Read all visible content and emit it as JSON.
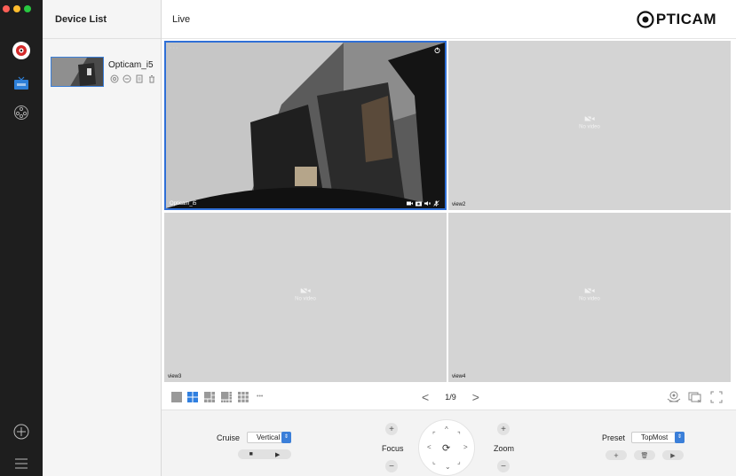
{
  "sidebar": {
    "nav": [
      "camera-logo-icon",
      "live-view-icon",
      "playback-reel-icon",
      "add-icon",
      "menu-icon"
    ]
  },
  "device_panel": {
    "title": "Device List",
    "devices": [
      {
        "name": "Opticam_i5",
        "actions": [
          "settings-icon",
          "link-icon",
          "file-icon",
          "delete-icon"
        ]
      }
    ]
  },
  "header": {
    "title": "Live",
    "brand": "PTICAM"
  },
  "views": [
    {
      "label": "Opticam_i5",
      "has_video": true
    },
    {
      "label": "view2",
      "has_video": false,
      "placeholder": "No video"
    },
    {
      "label": "view3",
      "has_video": false,
      "placeholder": "No video"
    },
    {
      "label": "view4",
      "has_video": false,
      "placeholder": "No video"
    }
  ],
  "toolbar": {
    "layouts": [
      "layout-1",
      "layout-4",
      "layout-6",
      "layout-8",
      "layout-9",
      "more"
    ],
    "more_label": "•••",
    "page": "1/9",
    "prev": "<",
    "next": ">"
  },
  "ptz": {
    "cruise_label": "Cruise",
    "cruise_value": "Vertical",
    "focus_label": "Focus",
    "zoom_label": "Zoom",
    "preset_label": "Preset",
    "preset_value": "TopMost",
    "plus": "+",
    "minus": "−",
    "stop": "■",
    "play": "▶",
    "add": "+",
    "delete": "🗑",
    "dpad": {
      "up": "^",
      "down": "⌄",
      "left": "<",
      "right": ">",
      "ul": "⌜",
      "ur": "⌝",
      "dl": "⌞",
      "dr": "⌟",
      "center": "⟳"
    }
  },
  "colors": {
    "accent": "#3b7fd9",
    "rail_bg": "#1e1e1e",
    "tile_bg": "#d4d4d4"
  }
}
